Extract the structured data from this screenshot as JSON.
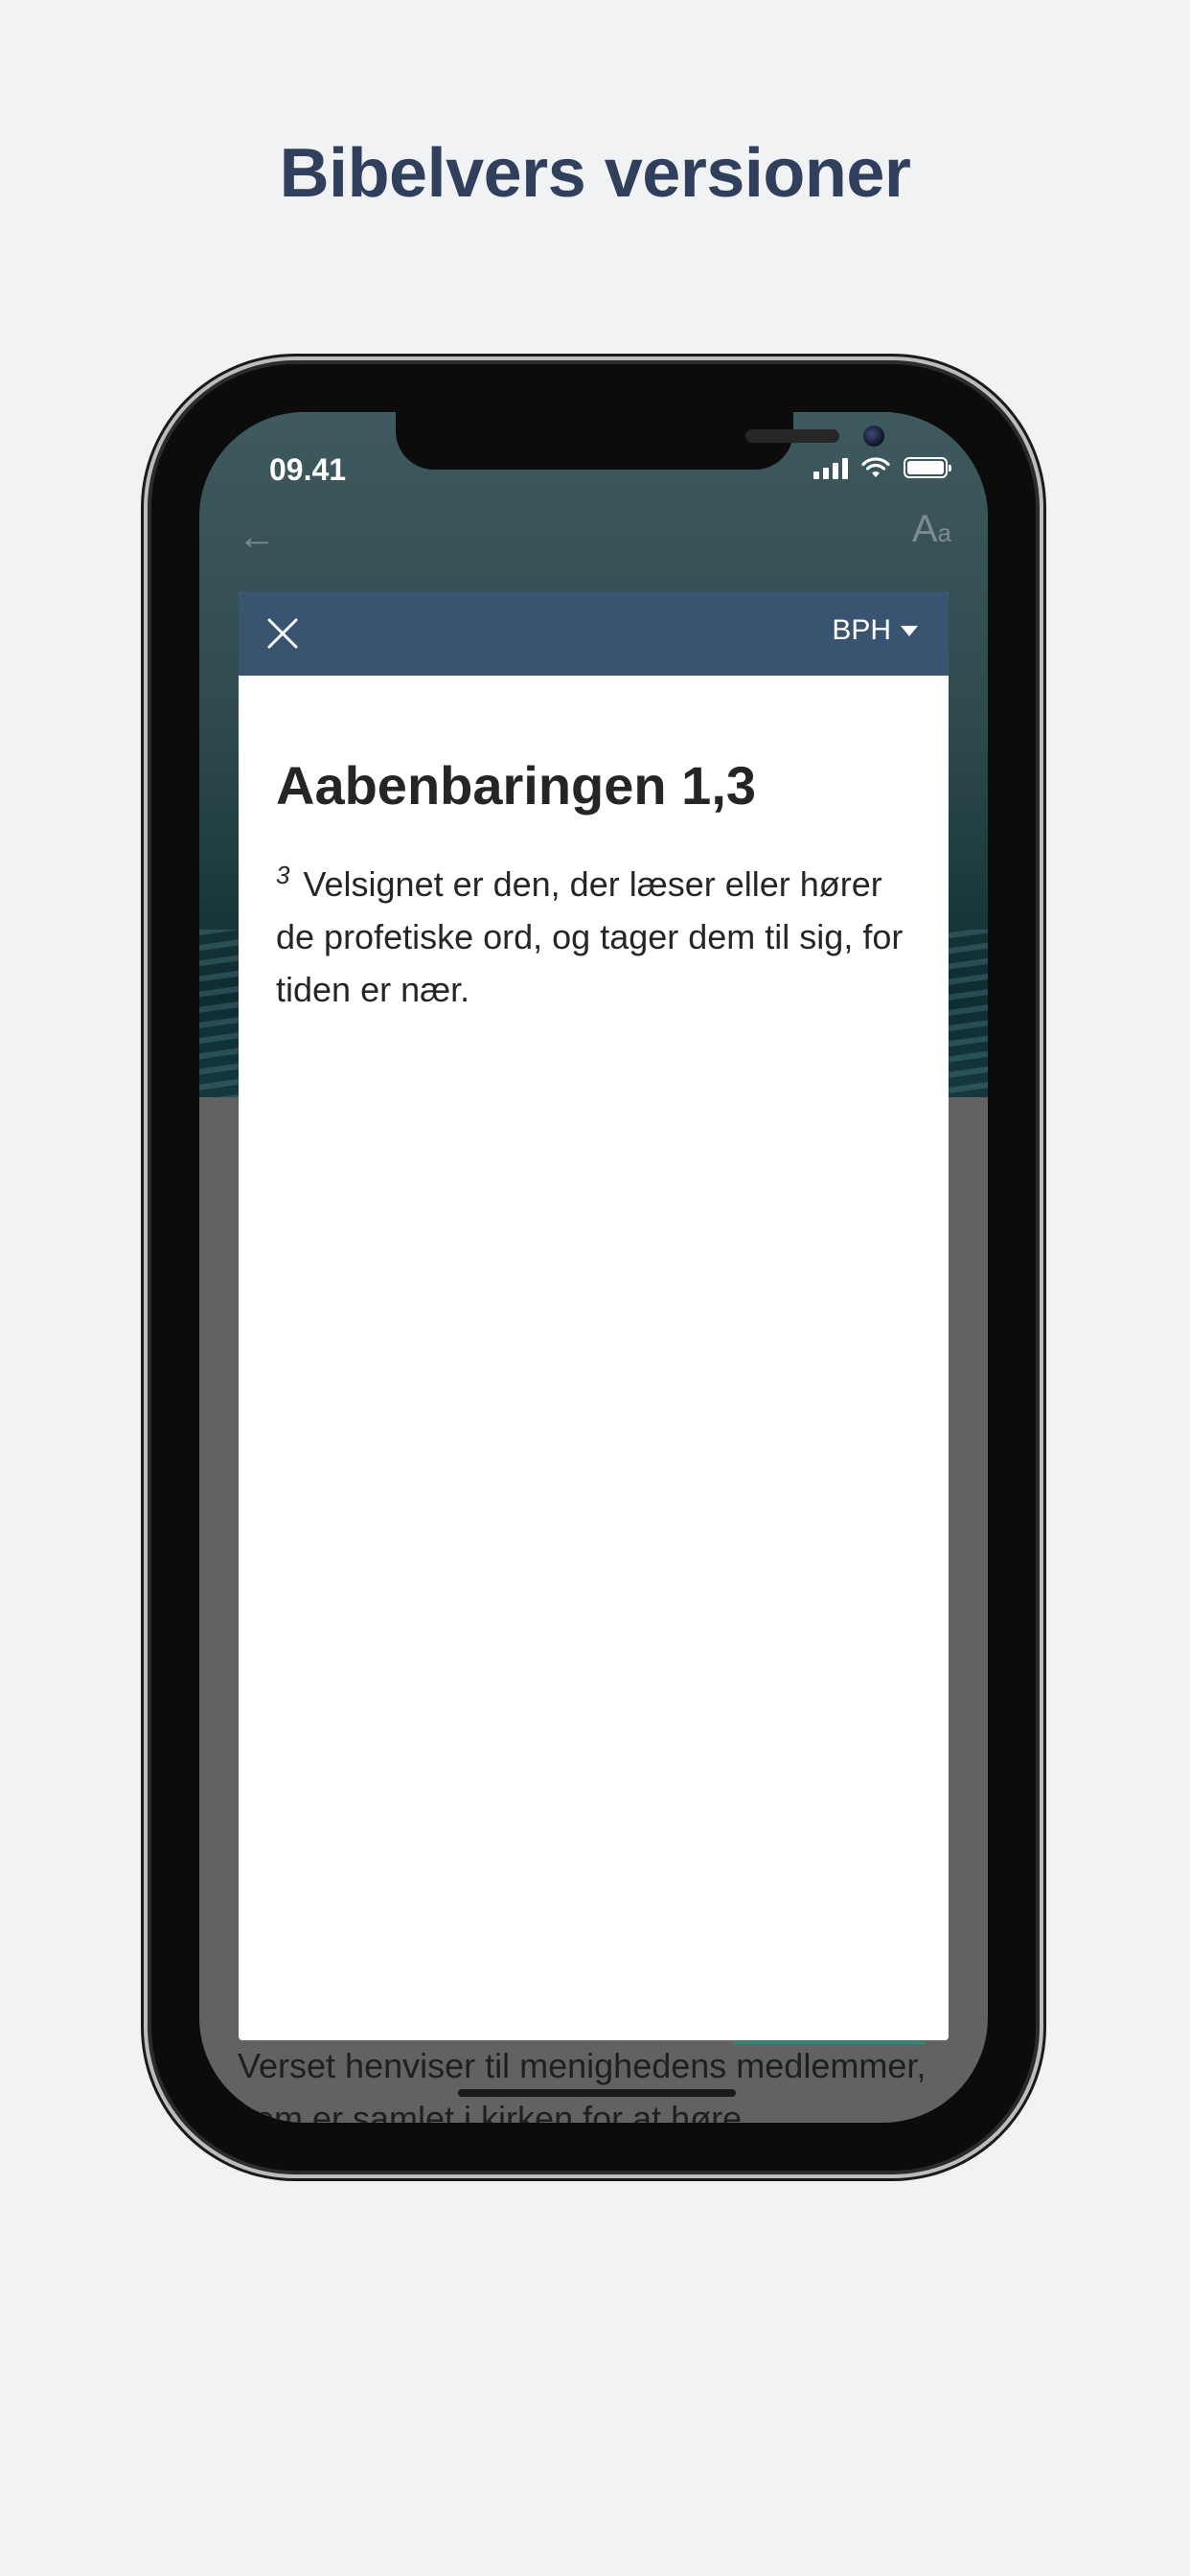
{
  "headline": "Bibelvers versioner",
  "status_bar": {
    "time": "09.41",
    "icons": [
      "signal-icon",
      "wifi-icon",
      "battery-icon"
    ]
  },
  "background_app": {
    "nav_icons": [
      "back-arrow-icon",
      "text-size-icon"
    ],
    "under_text": "Verset henviser til menighedens medlemmer, som er samlet i kirken for at høre"
  },
  "modal": {
    "header_color": "#385471",
    "close_icon": "close-icon",
    "version_label": "BPH",
    "version_caret_icon": "caret-down-icon",
    "reference": "Aabenbaringen 1,3",
    "verse_number": "3",
    "verse_text": "Velsignet er den, der læser eller hører de profetiske ord, og tager dem til sig, for tiden er nær."
  },
  "colors": {
    "page_background": "#f1f2f4",
    "headline": "#2f3f5c",
    "overlay_dim": "#626262",
    "accent_underline": "#2a8a74"
  }
}
